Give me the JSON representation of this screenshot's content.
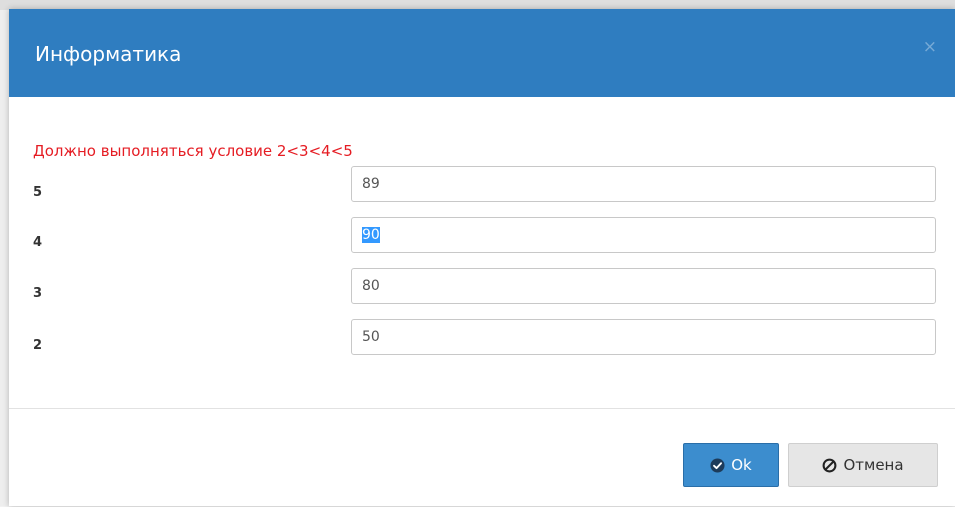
{
  "dialog": {
    "title": "Информатика",
    "close_glyph": "×",
    "warning": "Должно выполняться условие 2<3<4<5",
    "fields": [
      {
        "label": "5",
        "value": "89",
        "selected": false
      },
      {
        "label": "4",
        "value": "90",
        "selected": true
      },
      {
        "label": "3",
        "value": "80",
        "selected": false
      },
      {
        "label": "2",
        "value": "50",
        "selected": false
      }
    ],
    "ok_label": "Ok",
    "cancel_label": "Отмена"
  },
  "icons": {
    "ok": "check-circle-icon",
    "cancel": "ban-icon",
    "close": "close-icon"
  },
  "colors": {
    "header": "#2f7dc0",
    "warning": "#e51c23",
    "ok_button": "#3c8dce",
    "cancel_button": "#e6e6e6",
    "selection": "#3399ff"
  }
}
